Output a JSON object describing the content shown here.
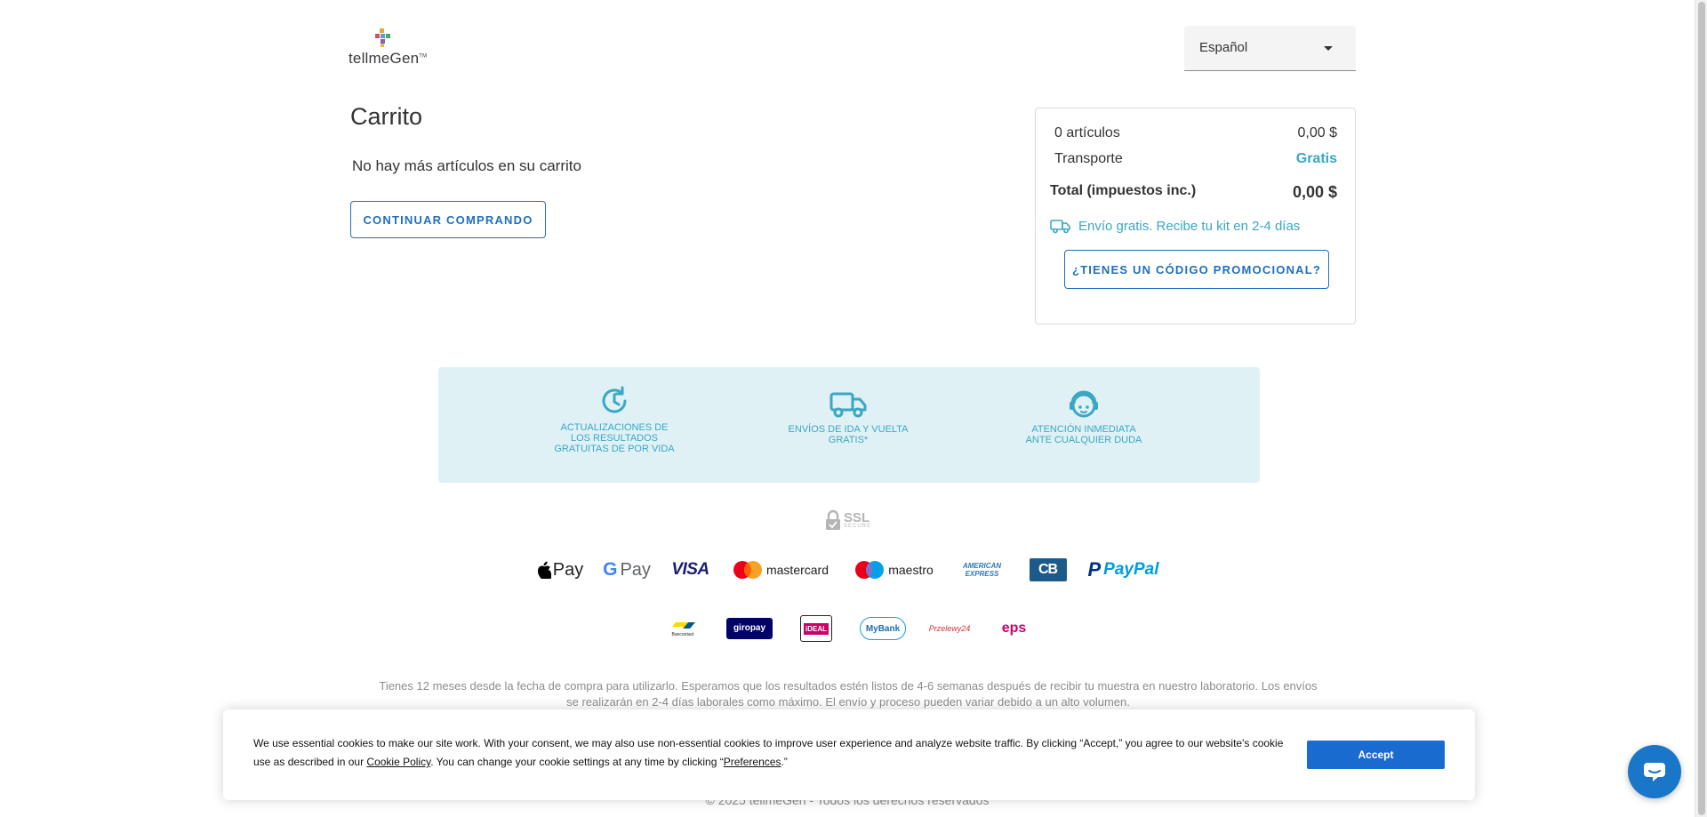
{
  "header": {
    "logo_text": "tellmeGen",
    "logo_tm": "TM",
    "language_selected": "Español"
  },
  "cart": {
    "title": "Carrito",
    "empty_message": "No hay más artículos en su carrito",
    "continue_button": "CONTINUAR COMPRANDO"
  },
  "summary": {
    "items_label": "0 artículos",
    "items_value": "0,00 $",
    "shipping_label": "Transporte",
    "shipping_value": "Gratis",
    "total_label": "Total (impuestos inc.)",
    "total_value": "0,00 $",
    "free_shipping_note": "Envío gratis. Recibe tu kit en 2-4 días",
    "promo_button": "¿TIENES UN CÓDIGO PROMOCIONAL?"
  },
  "benefits": [
    {
      "icon": "clock-refresh-icon",
      "lines": [
        "ACTUALIZACIONES DE",
        "LOS RESULTADOS",
        "GRATUITAS DE POR VIDA"
      ]
    },
    {
      "icon": "truck-icon",
      "lines": [
        "ENVÍOS DE IDA Y VUELTA",
        "GRATIS*"
      ]
    },
    {
      "icon": "support-agent-icon",
      "lines": [
        "ATENCIÓN INMEDIATA",
        "ANTE CUALQUIER DUDA"
      ]
    }
  ],
  "ssl": {
    "title": "SSL",
    "subtitle": "SECURE"
  },
  "payment_methods_row1": [
    {
      "name": "apple-pay-logo",
      "text": "Pay"
    },
    {
      "name": "google-pay-logo",
      "text": "Pay"
    },
    {
      "name": "visa-logo",
      "text": "VISA"
    },
    {
      "name": "mastercard-logo",
      "text": "mastercard"
    },
    {
      "name": "maestro-logo",
      "text": "maestro"
    },
    {
      "name": "american-express-logo",
      "text": "AMERICAN EXPRESS"
    },
    {
      "name": "carte-bancaire-logo",
      "text": "CB"
    },
    {
      "name": "paypal-logo",
      "text": "PayPal"
    }
  ],
  "payment_methods_row2": [
    {
      "name": "bancontact-logo",
      "text": "Bancontact"
    },
    {
      "name": "giropay-logo",
      "text": "giropay"
    },
    {
      "name": "ideal-logo",
      "text": "iDEAL"
    },
    {
      "name": "mybank-logo",
      "text": "MyBank"
    },
    {
      "name": "przelewy24-logo",
      "text": "Przelewy24"
    },
    {
      "name": "eps-logo",
      "text": "eps"
    }
  ],
  "footer": {
    "disclaimer": "Tienes 12 meses desde la fecha de compra para utilizarlo. Esperamos que los resultados estén listos de 4-6 semanas después de recibir tu muestra en nuestro laboratorio. Los envíos se realizarán en 2-4 días laborales como máximo. El envío y proceso pueden variar debido a un alto volumen.",
    "copyright": "© 2025 tellmeGen - Todos los derechos reservados"
  },
  "cookie_banner": {
    "text_before": "We use essential cookies to make our site work. With your consent, we may also use non-essential cookies to improve user experience and analyze website traffic. By clicking “Accept,” you agree to our website's cookie use as described in our ",
    "cookie_policy_link": "Cookie Policy",
    "text_middle": ". You can change your cookie settings at any time by clicking “",
    "preferences_link": "Preferences",
    "text_after": ".”",
    "accept_button": "Accept"
  },
  "colors": {
    "accent_blue": "#1f6fbf",
    "teal": "#3aa7c4",
    "benefit_bg": "#dff1f5",
    "accept_bg": "#1a6bd0"
  }
}
